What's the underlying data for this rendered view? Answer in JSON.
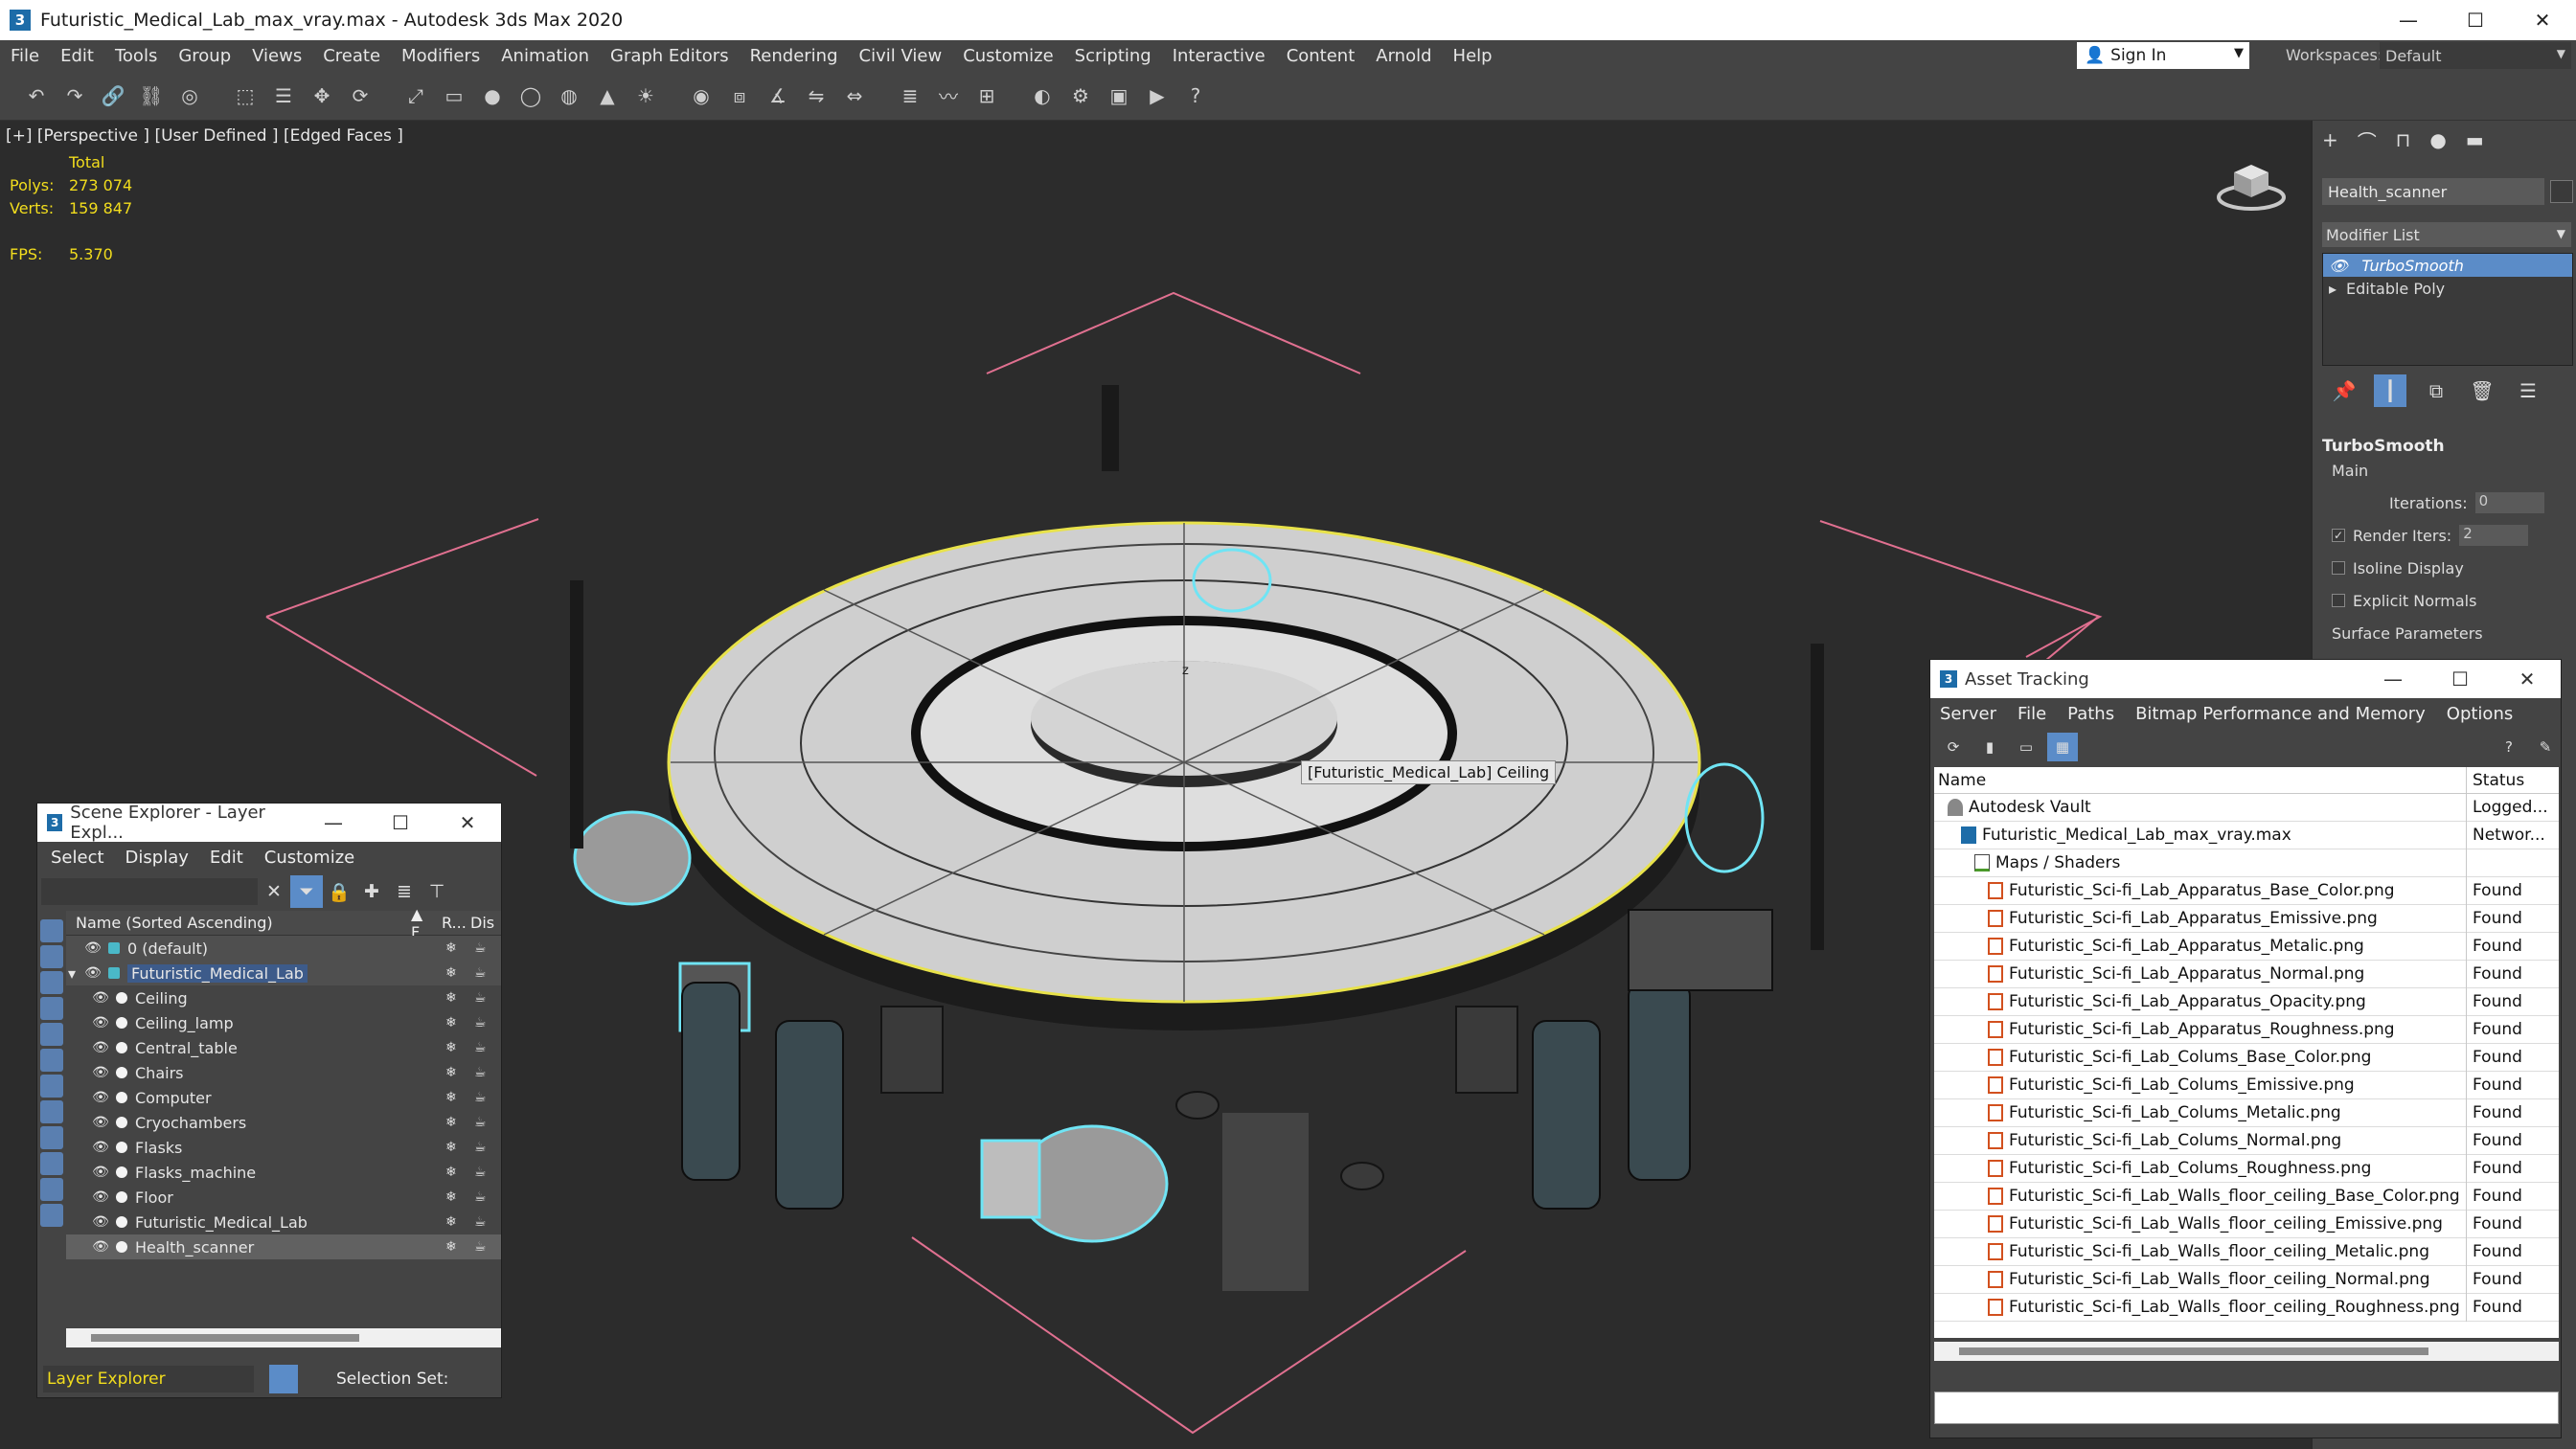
{
  "window": {
    "title": "Futuristic_Medical_Lab_max_vray.max - Autodesk 3ds Max 2020",
    "app_icon_letter": "3",
    "buttons": {
      "minimize": "—",
      "maximize": "☐",
      "close": "✕"
    }
  },
  "menubar": {
    "items": [
      "File",
      "Edit",
      "Tools",
      "Group",
      "Views",
      "Create",
      "Modifiers",
      "Animation",
      "Graph Editors",
      "Rendering",
      "Civil View",
      "Customize",
      "Scripting",
      "Interactive",
      "Content",
      "Arnold",
      "Help"
    ],
    "sign_in": "Sign In",
    "workspaces_label": "Workspaces:",
    "workspace_value": "Default"
  },
  "toolbar": {
    "icons": [
      "undo-icon",
      "redo-icon",
      "link-icon",
      "unlink-icon",
      "bind-icon",
      "select-icon",
      "select-name-icon",
      "move-icon",
      "rotate-icon",
      "scale-icon",
      "box-icon",
      "sphere-icon",
      "cylinder-icon",
      "torus-icon",
      "cone-icon",
      "light-icon",
      "camera-icon",
      "snap-icon",
      "angle-snap-icon",
      "mirror-icon",
      "align-icon",
      "layer-icon",
      "curve-editor-icon",
      "schematic-icon",
      "material-icon",
      "render-setup-icon",
      "render-frame-icon",
      "render-icon",
      "help-icon"
    ]
  },
  "viewport": {
    "label": "[+] [Perspective ] [User Defined ] [Edged Faces ]",
    "stats": {
      "header": "Total",
      "polys_label": "Polys:",
      "polys_value": "273 074",
      "verts_label": "Verts:",
      "verts_value": "159 847",
      "fps_label": "FPS:",
      "fps_value": "5.370"
    },
    "tooltip": "[Futuristic_Medical_Lab] Ceiling",
    "axis_label": "z"
  },
  "command_panel": {
    "tabs": [
      "+",
      "⌒",
      "⊓",
      "●",
      "▬"
    ],
    "object_name": "Health_scanner",
    "modifier_list_label": "Modifier List",
    "modifiers": [
      {
        "name": "TurboSmooth",
        "selected": true
      },
      {
        "name": "Editable Poly",
        "selected": false
      }
    ],
    "rollout": {
      "title": "TurboSmooth",
      "section": "Main",
      "iterations_label": "Iterations:",
      "iterations_value": "0",
      "render_iters_label": "Render Iters:",
      "render_iters_value": "2",
      "render_iters_checked": true,
      "isoline_label": "Isoline Display",
      "explicit_normals_label": "Explicit Normals",
      "surface_params_label": "Surface Parameters"
    }
  },
  "scene_explorer": {
    "title": "Scene Explorer - Layer Expl...",
    "menus": [
      "Select",
      "Display",
      "Edit",
      "Customize"
    ],
    "columns": {
      "name": "Name (Sorted Ascending)",
      "f": "▲ F...",
      "r": "R...",
      "d": "Dis"
    },
    "rows": [
      {
        "name": "0 (default)",
        "level": 0,
        "type": "layer",
        "expanded": false
      },
      {
        "name": "Futuristic_Medical_Lab",
        "level": 0,
        "type": "layer",
        "expanded": true,
        "highlight": true
      },
      {
        "name": "Ceiling",
        "level": 1
      },
      {
        "name": "Ceiling_lamp",
        "level": 1
      },
      {
        "name": "Central_table",
        "level": 1
      },
      {
        "name": "Chairs",
        "level": 1
      },
      {
        "name": "Computer",
        "level": 1
      },
      {
        "name": "Cryochambers",
        "level": 1
      },
      {
        "name": "Flasks",
        "level": 1
      },
      {
        "name": "Flasks_machine",
        "level": 1
      },
      {
        "name": "Floor",
        "level": 1
      },
      {
        "name": "Futuristic_Medical_Lab",
        "level": 1
      },
      {
        "name": "Health_scanner",
        "level": 1,
        "selected": true
      }
    ],
    "footer_select": "Layer Explorer",
    "selection_set_label": "Selection Set:"
  },
  "asset_tracking": {
    "title": "Asset Tracking",
    "menus": [
      "Server",
      "File",
      "Paths",
      "Bitmap Performance and Memory",
      "Options"
    ],
    "columns": {
      "name": "Name",
      "status": "Status"
    },
    "rows": [
      {
        "name": "Autodesk Vault",
        "status": "Logged...",
        "icon": "vault",
        "indent": 0
      },
      {
        "name": "Futuristic_Medical_Lab_max_vray.max",
        "status": "Networ...",
        "icon": "max",
        "indent": 1
      },
      {
        "name": "Maps / Shaders",
        "status": "",
        "icon": "folder",
        "indent": 2
      },
      {
        "name": "Futuristic_Sci-fi_Lab_Apparatus_Base_Color.png",
        "status": "Found",
        "icon": "png",
        "indent": 3
      },
      {
        "name": "Futuristic_Sci-fi_Lab_Apparatus_Emissive.png",
        "status": "Found",
        "icon": "png",
        "indent": 3
      },
      {
        "name": "Futuristic_Sci-fi_Lab_Apparatus_Metalic.png",
        "status": "Found",
        "icon": "png",
        "indent": 3
      },
      {
        "name": "Futuristic_Sci-fi_Lab_Apparatus_Normal.png",
        "status": "Found",
        "icon": "png",
        "indent": 3
      },
      {
        "name": "Futuristic_Sci-fi_Lab_Apparatus_Opacity.png",
        "status": "Found",
        "icon": "png",
        "indent": 3
      },
      {
        "name": "Futuristic_Sci-fi_Lab_Apparatus_Roughness.png",
        "status": "Found",
        "icon": "png",
        "indent": 3
      },
      {
        "name": "Futuristic_Sci-fi_Lab_Colums_Base_Color.png",
        "status": "Found",
        "icon": "png",
        "indent": 3
      },
      {
        "name": "Futuristic_Sci-fi_Lab_Colums_Emissive.png",
        "status": "Found",
        "icon": "png",
        "indent": 3
      },
      {
        "name": "Futuristic_Sci-fi_Lab_Colums_Metalic.png",
        "status": "Found",
        "icon": "png",
        "indent": 3
      },
      {
        "name": "Futuristic_Sci-fi_Lab_Colums_Normal.png",
        "status": "Found",
        "icon": "png",
        "indent": 3
      },
      {
        "name": "Futuristic_Sci-fi_Lab_Colums_Roughness.png",
        "status": "Found",
        "icon": "png",
        "indent": 3
      },
      {
        "name": "Futuristic_Sci-fi_Lab_Walls_floor_ceiling_Base_Color.png",
        "status": "Found",
        "icon": "png",
        "indent": 3
      },
      {
        "name": "Futuristic_Sci-fi_Lab_Walls_floor_ceiling_Emissive.png",
        "status": "Found",
        "icon": "png",
        "indent": 3
      },
      {
        "name": "Futuristic_Sci-fi_Lab_Walls_floor_ceiling_Metalic.png",
        "status": "Found",
        "icon": "png",
        "indent": 3
      },
      {
        "name": "Futuristic_Sci-fi_Lab_Walls_floor_ceiling_Normal.png",
        "status": "Found",
        "icon": "png",
        "indent": 3
      },
      {
        "name": "Futuristic_Sci-fi_Lab_Walls_floor_ceiling_Roughness.png",
        "status": "Found",
        "icon": "png",
        "indent": 3
      }
    ]
  },
  "colors": {
    "accent": "#5b8cc8",
    "stats_yellow": "#f2dd1d",
    "selection_cyan": "#6fe4f4",
    "grid_pink": "#e07090"
  }
}
